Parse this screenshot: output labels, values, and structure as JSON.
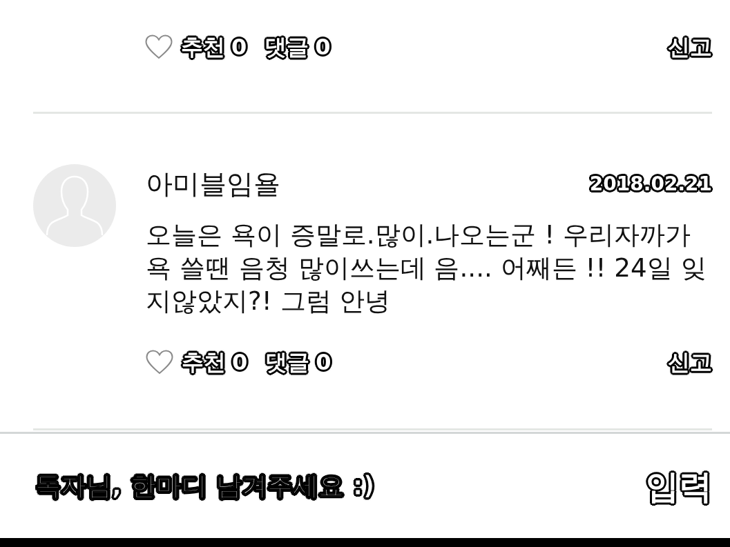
{
  "comments": [
    {
      "actions": {
        "liked": false,
        "like_label": "추천",
        "like_count": "0",
        "reply_label": "댓글",
        "reply_count": "0",
        "report": "신고"
      }
    },
    {
      "author": "아미블임욜",
      "date": "2018.02.21",
      "text": "오늘은 욕이 증말로.많이.나오는군 ! 우리자까가 욕 쓸땐 음청 많이쓰는데 음.... 어째든 !! 24일 잊지않았지?! 그럼 안녕",
      "actions": {
        "liked": false,
        "like_label": "추천",
        "like_count": "0",
        "reply_label": "댓글",
        "reply_count": "0",
        "report": "신고"
      }
    }
  ],
  "comment_input": {
    "placeholder": "독자님, 한마디 남겨주세요 :)",
    "submit": "입력"
  }
}
